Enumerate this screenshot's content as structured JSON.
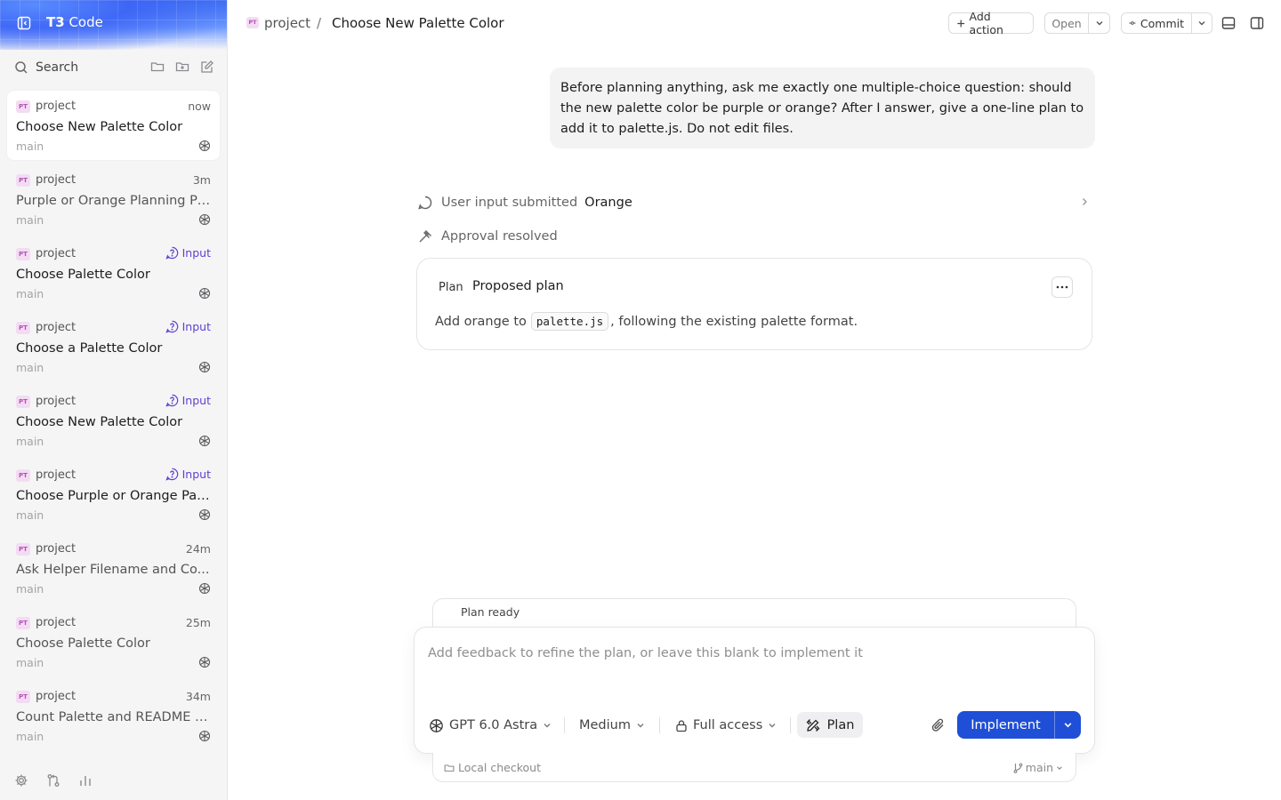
{
  "app": {
    "name_prefix": "T3",
    "name_suffix": " Code"
  },
  "sidebar": {
    "search_label": "Search",
    "threads": [
      {
        "badge": "PT",
        "project": "project",
        "time": "now",
        "title": "Choose New Palette Color",
        "branch": "main",
        "active": true
      },
      {
        "badge": "PT",
        "project": "project",
        "time": "3m",
        "title": "Purple or Orange Planning Pr...",
        "branch": "main"
      },
      {
        "badge": "PT",
        "project": "project",
        "status": "Input",
        "title": "Choose Palette Color",
        "branch": "main"
      },
      {
        "badge": "PT",
        "project": "project",
        "status": "Input",
        "title": "Choose a Palette Color",
        "branch": "main"
      },
      {
        "badge": "PT",
        "project": "project",
        "status": "Input",
        "title": "Choose New Palette Color",
        "branch": "main"
      },
      {
        "badge": "PT",
        "project": "project",
        "status": "Input",
        "title": "Choose Purple or Orange Pal...",
        "branch": "main"
      },
      {
        "badge": "PT",
        "project": "project",
        "time": "24m",
        "title": "Ask Helper Filename and Co...",
        "branch": "main"
      },
      {
        "badge": "PT",
        "project": "project",
        "time": "25m",
        "title": "Choose Palette Color",
        "branch": "main"
      },
      {
        "badge": "PT",
        "project": "project",
        "time": "34m",
        "title": "Count Palette and README L...",
        "branch": "main"
      }
    ]
  },
  "header": {
    "badge": "PT",
    "project": "project",
    "separator": "/",
    "title": "Choose New Palette Color",
    "add_action": "Add action",
    "open": "Open",
    "commit": "Commit"
  },
  "chat": {
    "user_message": "Before planning anything, ask me exactly one multiple-choice question: should the new palette color be purple or orange? After I answer, give a one-line plan to add it to palette.js. Do not edit files.",
    "event_input_label": "User input submitted",
    "event_input_value": "Orange",
    "event_approval": "Approval resolved",
    "plan": {
      "tag": "Plan",
      "title": "Proposed plan",
      "body_before": "Add orange to",
      "body_code": "palette.js",
      "body_after": ", following the existing palette format."
    }
  },
  "composer": {
    "plan_ready": "Plan ready",
    "placeholder": "Add feedback to refine the plan, or leave this blank to implement it",
    "model": "GPT 6.0 Astra",
    "effort": "Medium",
    "access": "Full access",
    "mode": "Plan",
    "implement": "Implement",
    "local_checkout": "Local checkout",
    "branch": "main"
  },
  "colors": {
    "accent": "#1f4fd6",
    "input_status": "#6040d0",
    "badge_bg": "#f3dcf3",
    "badge_fg": "#b84fb8"
  }
}
